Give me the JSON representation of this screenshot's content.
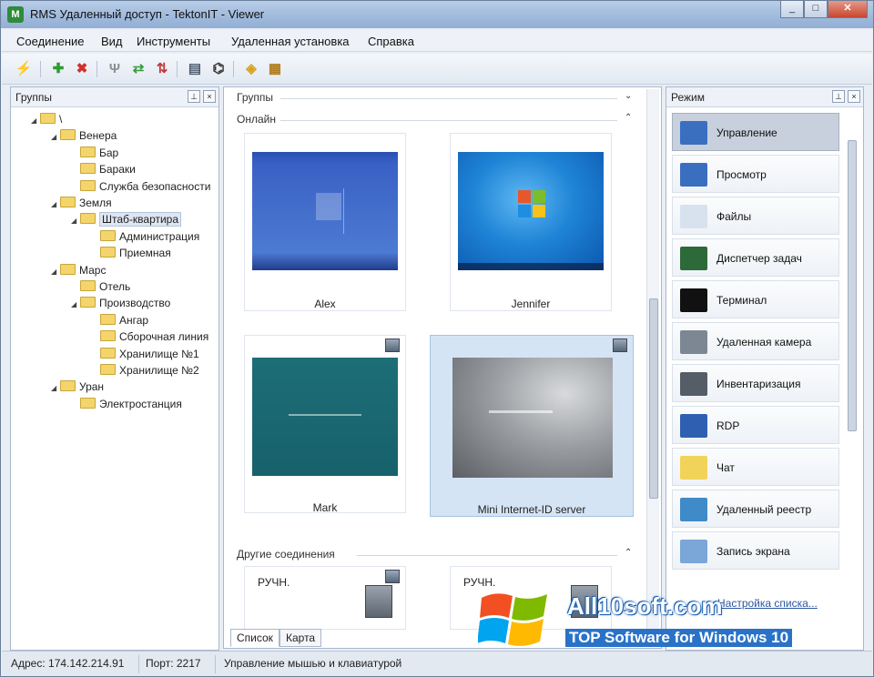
{
  "window": {
    "title": "RMS Удаленный доступ - TektonIT - Viewer"
  },
  "menu": [
    "Соединение",
    "Вид",
    "Инструменты",
    "Удаленная установка",
    "Справка"
  ],
  "left_panel": {
    "title": "Группы",
    "tree": [
      {
        "label": "\\",
        "level": 0
      },
      {
        "label": "Венера",
        "level": 1
      },
      {
        "label": "Бар",
        "level": 2
      },
      {
        "label": "Бараки",
        "level": 2
      },
      {
        "label": "Служба безопасности",
        "level": 2
      },
      {
        "label": "Земля",
        "level": 1
      },
      {
        "label": "Штаб-квартира",
        "level": 2,
        "selected": true
      },
      {
        "label": "Администрация",
        "level": 3
      },
      {
        "label": "Приемная",
        "level": 3
      },
      {
        "label": "Марс",
        "level": 1
      },
      {
        "label": "Отель",
        "level": 2
      },
      {
        "label": "Производство",
        "level": 2
      },
      {
        "label": "Ангар",
        "level": 3
      },
      {
        "label": "Сборочная линия",
        "level": 3
      },
      {
        "label": "Хранилище №1",
        "level": 3
      },
      {
        "label": "Хранилище №2",
        "level": 3
      },
      {
        "label": "Уран",
        "level": 1
      },
      {
        "label": "Электростанция",
        "level": 2
      }
    ]
  },
  "center_panel": {
    "groups_label": "Группы",
    "online_label": "Онлайн",
    "other_label": "Другие соединения",
    "online_items": [
      {
        "name": "Alex",
        "screen": "xp"
      },
      {
        "name": "Jennifer",
        "screen": "win7"
      },
      {
        "name": "Mark",
        "screen": "teal"
      },
      {
        "name": "Mini Internet-ID server",
        "screen": "gray",
        "selected": true
      }
    ],
    "other_items": [
      {
        "name": "РУЧН."
      },
      {
        "name": "РУЧН."
      }
    ],
    "tabs": [
      "Список",
      "Карта"
    ]
  },
  "right_panel": {
    "title": "Режим",
    "modes": [
      {
        "label": "Управление",
        "icon": "control-icon",
        "color": "#3a6fc0",
        "active": true
      },
      {
        "label": "Просмотр",
        "icon": "view-icon",
        "color": "#3a6fc0"
      },
      {
        "label": "Файлы",
        "icon": "files-icon",
        "color": "#d8e2ee"
      },
      {
        "label": "Диспетчер задач",
        "icon": "task-manager-icon",
        "color": "#2d6a3a"
      },
      {
        "label": "Терминал",
        "icon": "terminal-icon",
        "color": "#111111"
      },
      {
        "label": "Удаленная камера",
        "icon": "camera-icon",
        "color": "#7d8793"
      },
      {
        "label": "Инвентаризация",
        "icon": "inventory-icon",
        "color": "#555d66"
      },
      {
        "label": "RDP",
        "icon": "rdp-icon",
        "color": "#2f5fb0"
      },
      {
        "label": "Чат",
        "icon": "chat-icon",
        "color": "#f1d35a"
      },
      {
        "label": "Удаленный реестр",
        "icon": "registry-icon",
        "color": "#3f8ac8"
      },
      {
        "label": "Запись экрана",
        "icon": "screen-record-icon",
        "color": "#7aa6d8"
      }
    ],
    "link": "Настройка списка..."
  },
  "status": {
    "address": "Адрес: 174.142.214.91",
    "port": "Порт: 2217",
    "mode": "Управление мышью и клавиатурой"
  },
  "watermark": {
    "site": "All10soft.com",
    "tagline": "TOP Software for Windows 10"
  }
}
